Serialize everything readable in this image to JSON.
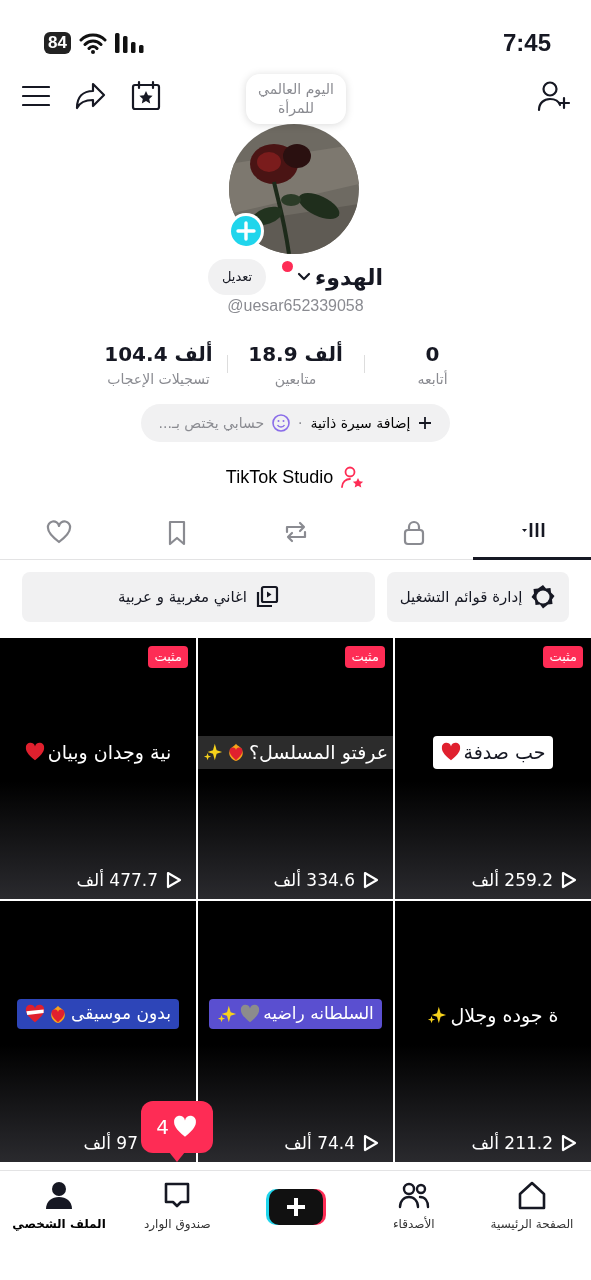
{
  "status_bar": {
    "time": "7:45",
    "battery": "84"
  },
  "tooltip": {
    "text": "اليوم العالمي للمرأة"
  },
  "profile": {
    "name": "الهدوء",
    "edit_button": "تعديل",
    "handle": "@uesar652339058"
  },
  "stats": [
    {
      "value": "0",
      "label": "أتابعه"
    },
    {
      "value": "18.9 ألف",
      "label": "متابعين"
    },
    {
      "value": "104.4 ألف",
      "label": "تسجيلات الإعجاب"
    }
  ],
  "bio": {
    "action": "إضافة سيرة ذاتية",
    "separator": "·",
    "hint": "حسابي يختص بـ..."
  },
  "studio": {
    "label": "TikTok Studio"
  },
  "tabs": [
    {
      "kind": "grid",
      "selected": true
    },
    {
      "kind": "lock",
      "selected": false
    },
    {
      "kind": "repost",
      "selected": false
    },
    {
      "kind": "bookmark",
      "selected": false
    },
    {
      "kind": "heart",
      "selected": false
    }
  ],
  "playlists": [
    {
      "kind": "manage",
      "label": "إدارة قوائم التشغيل"
    },
    {
      "kind": "playlist",
      "label": "اغاني  مغربية و عربية"
    }
  ],
  "videos": [
    {
      "badge": "مثبت",
      "caption": {
        "kind": "white",
        "text": "حب صدفة",
        "emojis": [
          {
            "kind": "red-heart"
          }
        ]
      },
      "views": "259.2 ألف",
      "play_icon": true
    },
    {
      "badge": "مثبت",
      "caption": {
        "kind": "shaded",
        "text": "عرفتو المسلسل؟",
        "emojis": [
          {
            "kind": "fire-heart"
          },
          {
            "kind": "sparkles"
          }
        ]
      },
      "views": "334.6 ألف",
      "play_icon": true
    },
    {
      "badge": "مثبت",
      "caption": {
        "kind": "plain",
        "text": "نية وجدان وبيان",
        "emojis": [
          {
            "kind": "red-heart"
          }
        ]
      },
      "views": "477.7 ألف",
      "play_icon": true
    },
    {
      "caption": {
        "kind": "plain",
        "text": "ة جوده وجلال",
        "emojis": [
          {
            "kind": "sparkles"
          }
        ]
      },
      "views": "211.2 ألف",
      "play_icon": true
    },
    {
      "caption": {
        "kind": "purple",
        "text": "السلطانه راضيه",
        "emojis": [
          {
            "kind": "grey-heart"
          },
          {
            "kind": "sparkles"
          }
        ]
      },
      "views": "74.4 ألف",
      "play_icon": true
    },
    {
      "caption": {
        "kind": "blue",
        "text": "بدون موسيقى",
        "emojis": [
          {
            "kind": "fire-heart"
          },
          {
            "kind": "bandaged-heart"
          }
        ]
      },
      "views": "97 ألف",
      "play_icon": false
    }
  ],
  "notification": {
    "count": "4"
  },
  "nav": [
    {
      "kind": "home",
      "label": "الصفحة الرئيسية",
      "selected": false
    },
    {
      "kind": "friends",
      "label": "الأصدقاء",
      "selected": false
    },
    {
      "kind": "create",
      "selected": false
    },
    {
      "kind": "inbox",
      "label": "صندوق الوارد",
      "selected": false
    },
    {
      "kind": "profile",
      "label": "الملف الشخصي",
      "selected": true
    }
  ]
}
